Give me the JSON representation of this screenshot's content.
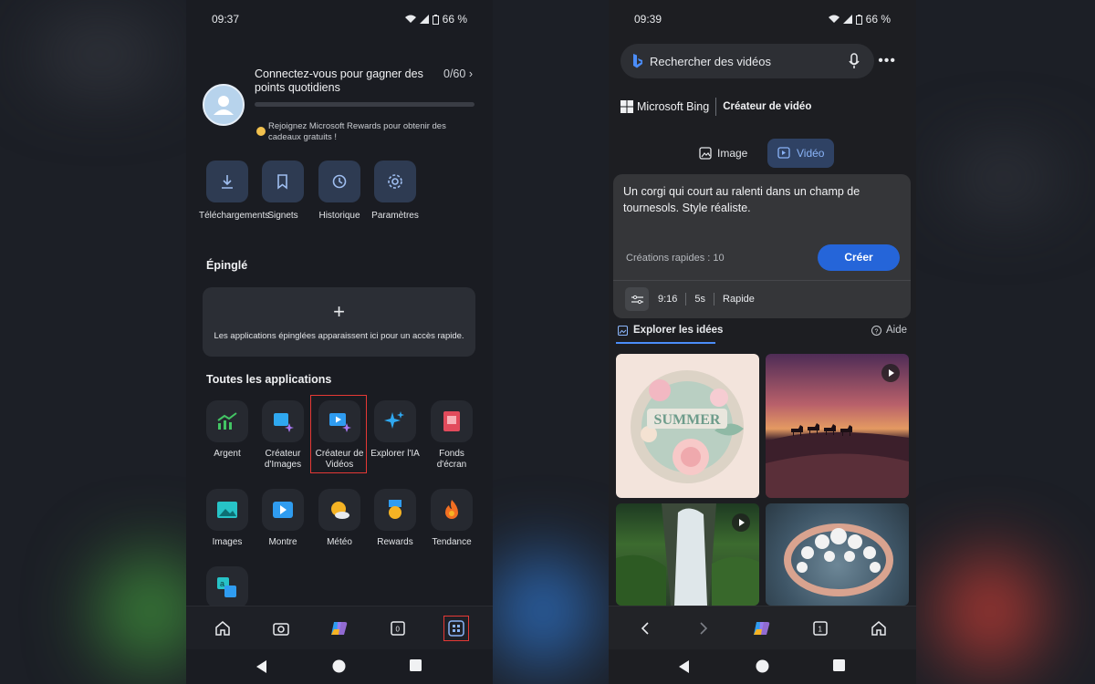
{
  "left_phone": {
    "status": {
      "time": "09:37",
      "battery": "66 %"
    },
    "rewards": {
      "title": "Connectez-vous pour gagner des points quotidiens",
      "count": "0/60",
      "progress": 0,
      "note": "Rejoignez Microsoft Rewards pour obtenir des cadeaux gratuits !"
    },
    "quick_actions": [
      {
        "label": "Téléchargements",
        "icon": "download-icon"
      },
      {
        "label": "Signets",
        "icon": "bookmark-icon"
      },
      {
        "label": "Historique",
        "icon": "history-icon"
      },
      {
        "label": "Paramètres",
        "icon": "gear-icon"
      }
    ],
    "pinned": {
      "heading": "Épinglé",
      "plus": "+",
      "message": "Les applications épinglées apparaissent ici pour un accès rapide."
    },
    "all_apps": {
      "heading": "Toutes les applications",
      "apps": [
        {
          "label": "Argent",
          "icon": "money-chart-icon"
        },
        {
          "label": "Créateur d'Images",
          "icon": "image-creator-icon"
        },
        {
          "label": "Créateur de Vidéos",
          "icon": "video-creator-icon",
          "highlighted": true
        },
        {
          "label": "Explorer l'IA",
          "icon": "sparkle-icon"
        },
        {
          "label": "Fonds d'écran",
          "icon": "wallpaper-icon"
        },
        {
          "label": "Images",
          "icon": "images-icon"
        },
        {
          "label": "Montre",
          "icon": "watch-icon"
        },
        {
          "label": "Météo",
          "icon": "weather-icon"
        },
        {
          "label": "Rewards",
          "icon": "rewards-icon"
        },
        {
          "label": "Tendance",
          "icon": "flame-icon"
        },
        {
          "label": "",
          "icon": "translate-icon"
        }
      ]
    },
    "bottom_bar": {
      "tab_count": "0",
      "icons": [
        "home-icon",
        "camera-icon",
        "copilot-icon",
        "tabs-icon",
        "apps-grid-icon"
      ]
    }
  },
  "right_phone": {
    "status": {
      "time": "09:39",
      "battery": "66 %"
    },
    "search": {
      "placeholder": "Rechercher des vidéos"
    },
    "brand": {
      "name": "Microsoft Bing",
      "product": "Créateur de vidéo"
    },
    "modes": [
      {
        "label": "Image",
        "active": false
      },
      {
        "label": "Vidéo",
        "active": true
      }
    ],
    "prompt": {
      "text": "Un corgi qui court au ralenti dans un champ de tournesols. Style réaliste.",
      "quota": "Créations rapides : 10",
      "create_label": "Créer",
      "options": {
        "ratio": "9:16",
        "duration": "5s",
        "speed": "Rapide"
      }
    },
    "explore": {
      "label": "Explorer les idées",
      "help": "Aide"
    },
    "tiles": [
      {
        "name": "summer-paper-flowers",
        "text": "SUMMER",
        "video": false
      },
      {
        "name": "desert-camels-sunset",
        "video": true
      },
      {
        "name": "waterfall-forest",
        "video": true
      },
      {
        "name": "pearl-ring",
        "video": false
      }
    ],
    "bottom_bar": {
      "tab_count": "1",
      "icons": [
        "back-icon",
        "forward-icon",
        "copilot-icon",
        "tabs-icon",
        "home-icon"
      ]
    }
  }
}
